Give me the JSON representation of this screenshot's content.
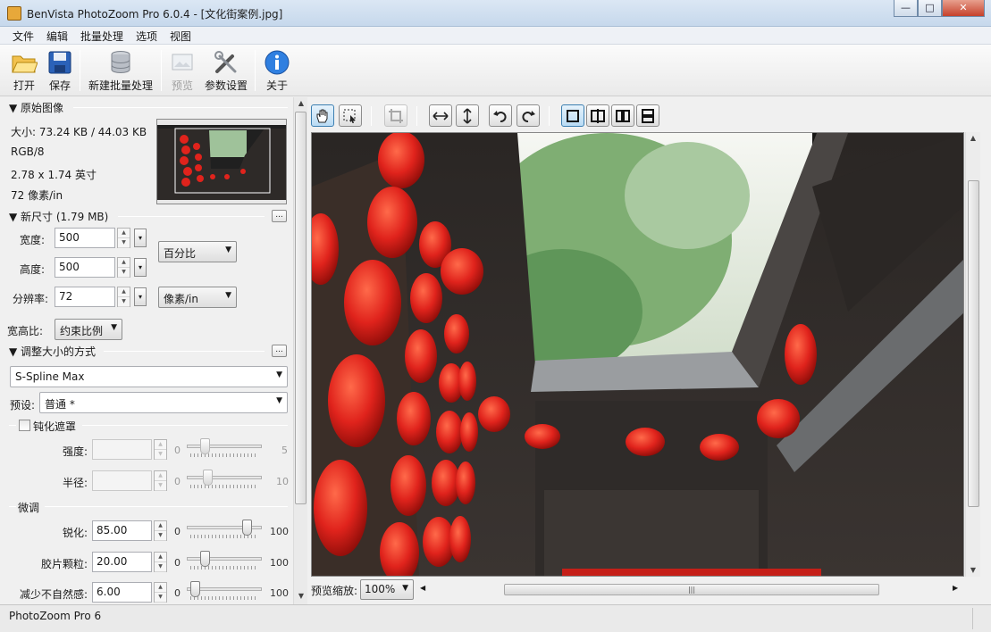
{
  "window": {
    "title": "BenVista PhotoZoom Pro 6.0.4 - [文化街案例.jpg]"
  },
  "menu": [
    "文件",
    "编辑",
    "批量处理",
    "选项",
    "视图"
  ],
  "toolbar": {
    "open": "打开",
    "save": "保存",
    "new_batch": "新建批量处理",
    "preview": "预览",
    "settings": "参数设置",
    "about": "关于"
  },
  "original": {
    "header": "▼ 原始图像",
    "size": "大小: 73.24 KB / 44.03 KB",
    "mode": "RGB/8",
    "dimensions": "2.78 x 1.74 英寸",
    "resolution": "72 像素/in"
  },
  "new_size": {
    "header": "▼ 新尺寸 (1.79 MB)",
    "more_button": "...",
    "width_label": "宽度:",
    "width_value": "500",
    "height_label": "高度:",
    "height_value": "500",
    "resolution_label": "分辨率:",
    "resolution_value": "72",
    "unit_size": "百分比",
    "unit_resolution": "像素/in",
    "aspect_label": "宽高比:",
    "aspect_value": "约束比例"
  },
  "resize_method": {
    "header": "▼ 调整大小的方式",
    "more_button": "...",
    "method": "S-Spline Max",
    "preset_label": "预设:",
    "preset_value": "普通 *"
  },
  "unsharp": {
    "header": "钝化遮罩",
    "checked": false,
    "strength_label": "强度:",
    "strength_value": "",
    "strength_min": "0",
    "strength_max": "5",
    "strength_level": 0.2,
    "radius_label": "半径:",
    "radius_value": "",
    "radius_min": "0",
    "radius_max": "10",
    "radius_level": 0.24
  },
  "fine_tune": {
    "header": "微调",
    "sharpen_label": "锐化:",
    "sharpen_value": "85.00",
    "sharpen_min": "0",
    "sharpen_max": "100",
    "film_grain_label": "胶片颗粒:",
    "film_grain_value": "20.00",
    "film_grain_min": "0",
    "film_grain_max": "100",
    "artifact_label": "减少不自然感:",
    "artifact_value": "6.00",
    "artifact_min": "0",
    "artifact_max": "100"
  },
  "preview_zoom": {
    "label": "预览缩放:",
    "value": "100%"
  },
  "status": {
    "text": "PhotoZoom Pro 6"
  },
  "icons": {
    "hand": "hand-icon",
    "select": "marquee-select-icon",
    "crop": "crop-icon",
    "flip_h": "flip-horizontal-icon",
    "flip_v": "flip-vertical-icon",
    "rotate_left": "rotate-left-icon",
    "rotate_right": "rotate-right-icon",
    "view_single": "single-view-icon",
    "view_split_v": "split-vertical-icon",
    "view_side": "side-by-side-icon",
    "view_split_h": "split-horizontal-icon"
  },
  "colors": {
    "accent": "#3c7fb1",
    "lantern": "#e0231c"
  }
}
